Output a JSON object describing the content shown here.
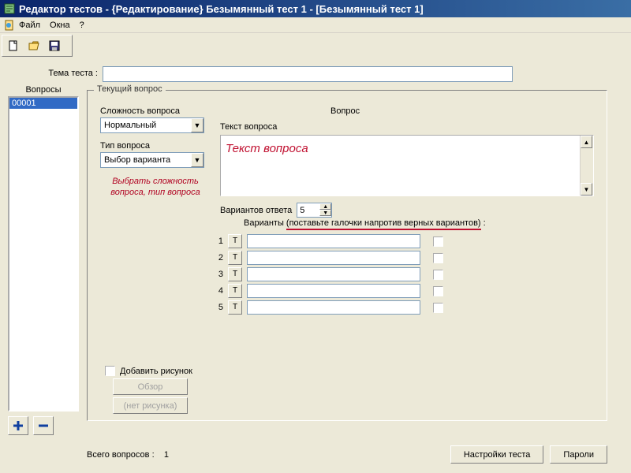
{
  "window": {
    "title": "Редактор тестов - {Редактирование} Безымянный тест 1 - [Безымянный тест 1]"
  },
  "menu": {
    "file": "Файл",
    "windows": "Окна",
    "help": "?"
  },
  "theme": {
    "label": "Тема теста :",
    "value": ""
  },
  "left": {
    "questions_label": "Вопросы",
    "selected_question": "00001"
  },
  "group": {
    "legend": "Текущий вопрос",
    "difficulty_label": "Сложность вопроса",
    "difficulty_value": "Нормальный",
    "type_label": "Тип вопроса",
    "type_value": "Выбор варианта",
    "helper_text": "Выбрать сложность вопроса, тип вопроса",
    "question_heading": "Вопрос",
    "question_text_label": "Текст вопроса",
    "question_text_value": "Текст вопроса",
    "answers_count_label": "Вариантов ответа",
    "answers_count_value": "5",
    "variants_label_a": "Варианты ",
    "variants_label_b": "(поставьте галочки напротив верных вариантов)",
    "variants_label_c": " :",
    "rows": [
      "1",
      "2",
      "3",
      "4",
      "5"
    ],
    "t_letter": "Т",
    "add_picture_label": "Добавить рисунок",
    "browse_label": "Обзор",
    "no_picture_label": "(нет рисунка)"
  },
  "bottom": {
    "total_label": "Всего вопросов :",
    "total_value": "1",
    "settings_btn": "Настройки теста",
    "passwords_btn": "Пароли"
  }
}
